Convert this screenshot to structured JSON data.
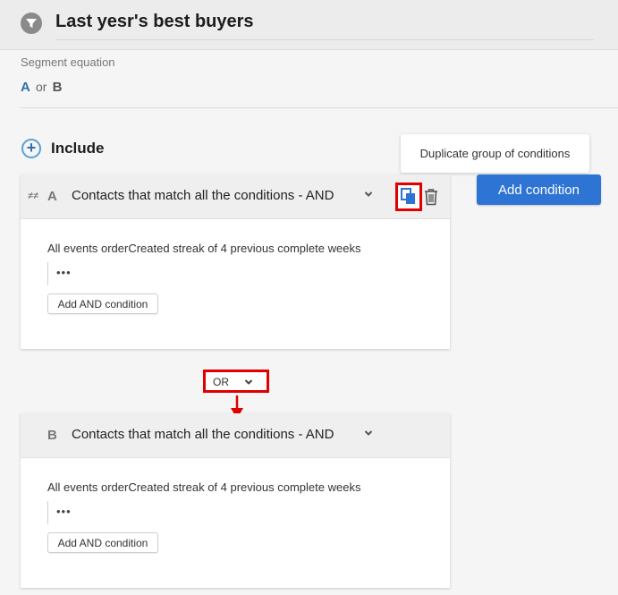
{
  "header": {
    "title": "Last yesr's best buyers",
    "icon": "funnel-icon"
  },
  "segment": {
    "label": "Segment equation",
    "a": "A",
    "or": "or",
    "b": "B"
  },
  "include": {
    "label": "Include"
  },
  "tooltip": {
    "text": "Duplicate group of conditions"
  },
  "add_condition": {
    "label": "Add condition"
  },
  "groups": [
    {
      "letter": "A",
      "title": "Contacts that match all the conditions - AND",
      "condition": "All events orderCreated  streak of  4  previous complete weeks",
      "dots": "•••",
      "add_and": "Add AND condition"
    },
    {
      "letter": "B",
      "title": "Contacts that match all the conditions - AND",
      "condition": "All events orderCreated  streak of  4  previous complete weeks",
      "dots": "•••",
      "add_and": "Add AND condition"
    }
  ],
  "join": {
    "label": "OR"
  },
  "colors": {
    "primary": "#2e74d4",
    "highlight": "#e00000",
    "link": "#2f6fad"
  }
}
